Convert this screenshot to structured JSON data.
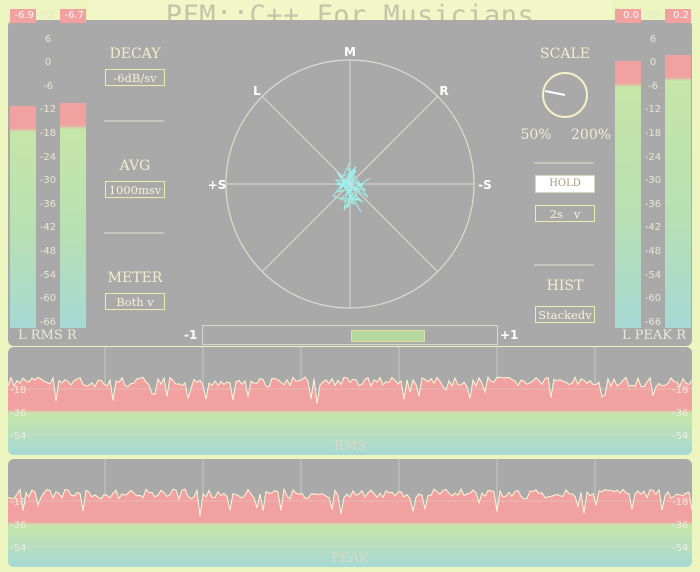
{
  "app": {
    "title": "PFM::C++ For Musicians"
  },
  "rms_meter": {
    "peak_left": "-6.9",
    "peak_right": "-6.7",
    "label": "L RMS R",
    "level_left": 0.74,
    "level_right": 0.75,
    "ticks": [
      "12",
      "6",
      "0",
      "-6",
      "-12",
      "-18",
      "-24",
      "-30",
      "-36",
      "-42",
      "-48",
      "-54",
      "-60",
      "-66"
    ]
  },
  "peak_meter": {
    "peak_left": "0.0",
    "peak_right": "0.2",
    "label": "L PEAK R",
    "level_left": 0.89,
    "level_right": 0.91,
    "ticks": [
      "12",
      "6",
      "0",
      "-6",
      "-12",
      "-18",
      "-24",
      "-30",
      "-36",
      "-42",
      "-48",
      "-54",
      "-60",
      "-66"
    ]
  },
  "controls_left": {
    "decay": {
      "label": "DECAY",
      "value": "-6dB/s"
    },
    "avg": {
      "label": "AVG",
      "value": "1000ms"
    },
    "meter": {
      "label": "METER",
      "value": "Both"
    }
  },
  "goniometer": {
    "labels": {
      "top": "M",
      "upper_left": "L",
      "upper_right": "R",
      "left": "+S",
      "right": "-S"
    }
  },
  "correlation": {
    "min_label": "-1",
    "max_label": "+1",
    "fill_from": 0.0,
    "fill_to": 0.5
  },
  "controls_right": {
    "scale": {
      "label": "SCALE",
      "min_label": "50%",
      "max_label": "200%"
    },
    "hold": {
      "label": "HOLD",
      "value": "2s"
    },
    "hist": {
      "label": "HIST",
      "value": "Stacked"
    }
  },
  "history_rms": {
    "label": "RMS",
    "ticks": [
      "-18",
      "-36",
      "-54"
    ]
  },
  "history_peak": {
    "label": "PEAK",
    "ticks": [
      "-18",
      "-36",
      "-54"
    ]
  },
  "colors": {
    "background": "#ecf5bf",
    "panel": "#a9a9a9",
    "meter_red": "#f0a1a0",
    "meter_green": "#c6e6a8",
    "meter_cyan": "#a6d9d4",
    "scope_trace": "#9ef0ec"
  }
}
